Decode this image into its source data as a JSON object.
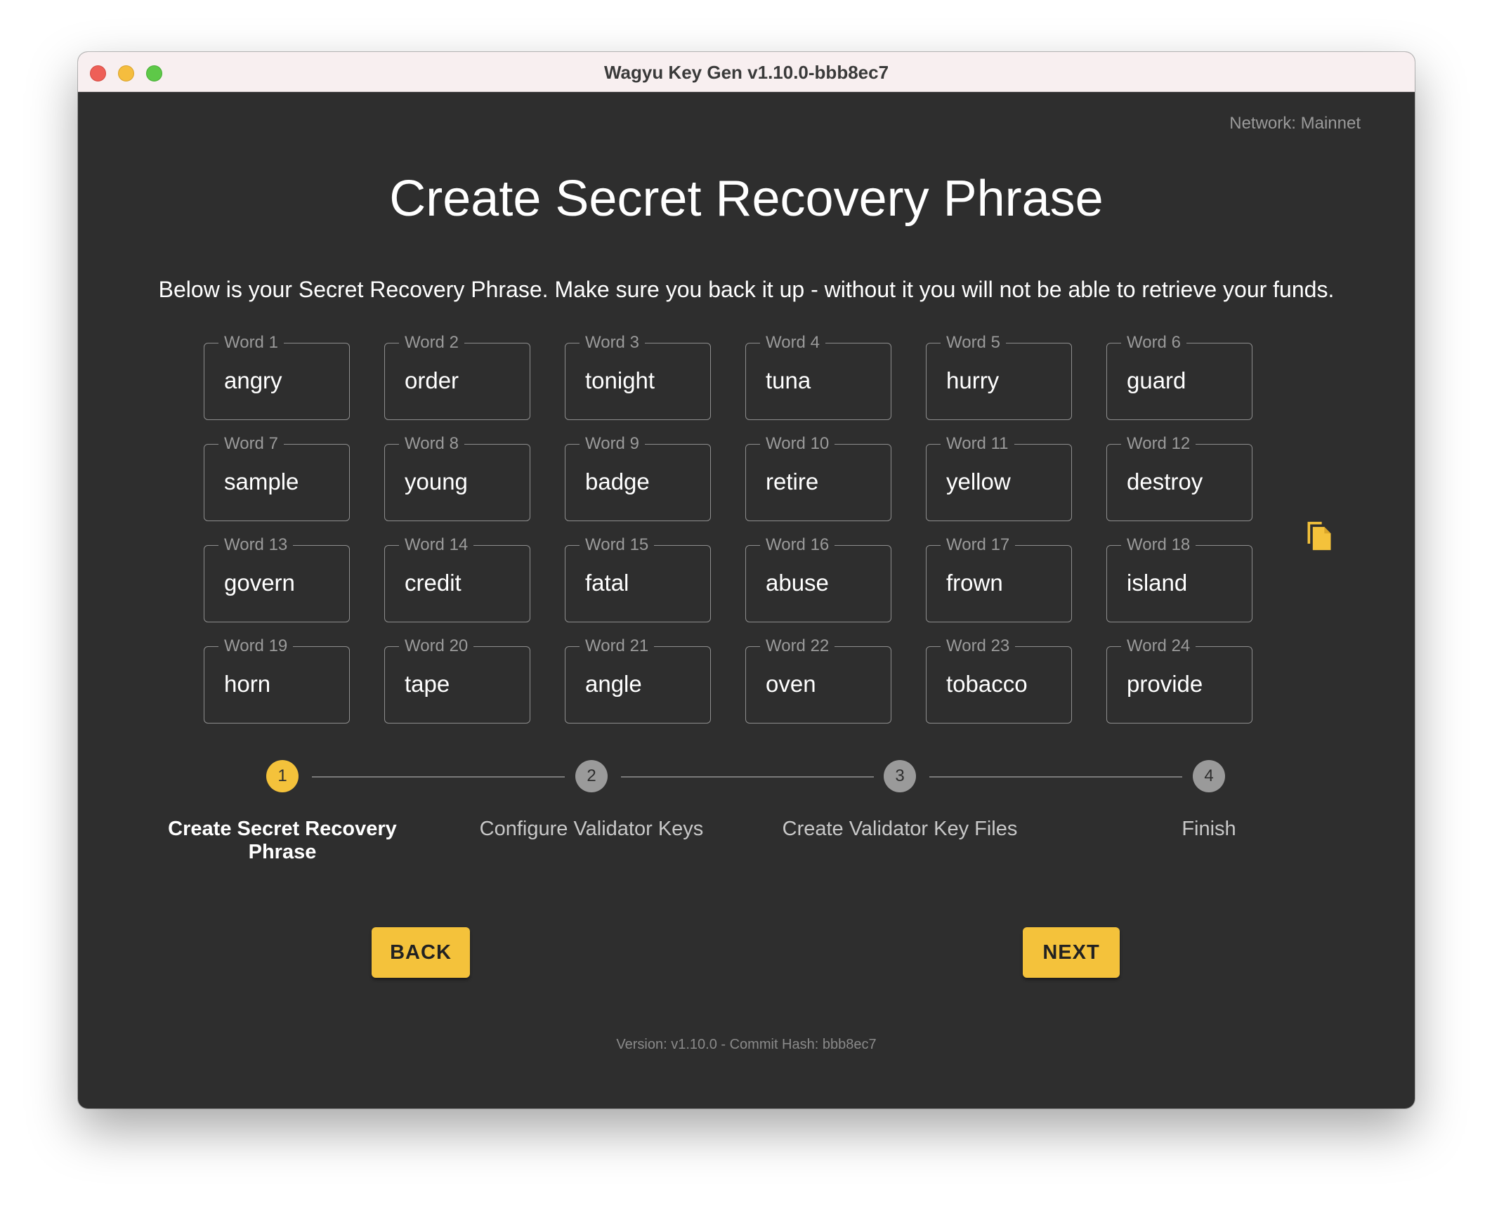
{
  "window": {
    "title": "Wagyu Key Gen v1.10.0-bbb8ec7"
  },
  "network_label": "Network: Mainnet",
  "heading": "Create Secret Recovery Phrase",
  "description": "Below is your Secret Recovery Phrase. Make sure you back it up - without it you will not be able to retrieve your funds.",
  "words": [
    {
      "label": "Word 1",
      "value": "angry"
    },
    {
      "label": "Word 2",
      "value": "order"
    },
    {
      "label": "Word 3",
      "value": "tonight"
    },
    {
      "label": "Word 4",
      "value": "tuna"
    },
    {
      "label": "Word 5",
      "value": "hurry"
    },
    {
      "label": "Word 6",
      "value": "guard"
    },
    {
      "label": "Word 7",
      "value": "sample"
    },
    {
      "label": "Word 8",
      "value": "young"
    },
    {
      "label": "Word 9",
      "value": "badge"
    },
    {
      "label": "Word 10",
      "value": "retire"
    },
    {
      "label": "Word 11",
      "value": "yellow"
    },
    {
      "label": "Word 12",
      "value": "destroy"
    },
    {
      "label": "Word 13",
      "value": "govern"
    },
    {
      "label": "Word 14",
      "value": "credit"
    },
    {
      "label": "Word 15",
      "value": "fatal"
    },
    {
      "label": "Word 16",
      "value": "abuse"
    },
    {
      "label": "Word 17",
      "value": "frown"
    },
    {
      "label": "Word 18",
      "value": "island"
    },
    {
      "label": "Word 19",
      "value": "horn"
    },
    {
      "label": "Word 20",
      "value": "tape"
    },
    {
      "label": "Word 21",
      "value": "angle"
    },
    {
      "label": "Word 22",
      "value": "oven"
    },
    {
      "label": "Word 23",
      "value": "tobacco"
    },
    {
      "label": "Word 24",
      "value": "provide"
    }
  ],
  "copy_icon": "copy-icon",
  "steps": [
    {
      "number": "1",
      "label": "Create Secret Recovery Phrase",
      "active": true
    },
    {
      "number": "2",
      "label": "Configure Validator Keys",
      "active": false
    },
    {
      "number": "3",
      "label": "Create Validator Key Files",
      "active": false
    },
    {
      "number": "4",
      "label": "Finish",
      "active": false
    }
  ],
  "buttons": {
    "back": "BACK",
    "next": "NEXT"
  },
  "footer": "Version: v1.10.0 - Commit Hash: bbb8ec7",
  "colors": {
    "accent": "#f4c23b",
    "background": "#2e2e2e",
    "titlebar": "#f8eff0"
  }
}
